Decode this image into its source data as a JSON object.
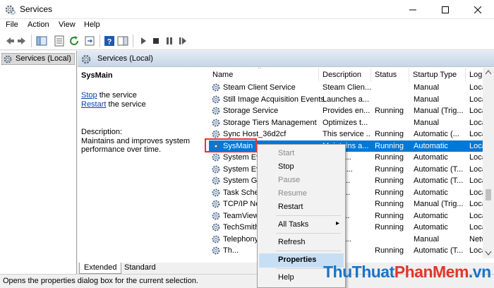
{
  "window": {
    "title": "Services"
  },
  "menubar": [
    "File",
    "Action",
    "View",
    "Help"
  ],
  "tree": {
    "node_label": "Services (Local)"
  },
  "panel": {
    "header": "Services (Local)",
    "service_name": "SysMain",
    "stop_link": "Stop",
    "stop_rest": " the service",
    "restart_link": "Restart",
    "restart_rest": " the service",
    "description_label": "Description:",
    "description_text": "Maintains and improves system performance over time."
  },
  "columns": [
    "Name",
    "Description",
    "Status",
    "Startup Type",
    "Log"
  ],
  "rows": [
    {
      "name": "Steam Client Service",
      "desc": "Steam Clien...",
      "status": "",
      "stype": "Manual",
      "logon": "Loca"
    },
    {
      "name": "Still Image Acquisition Events",
      "desc": "Launches a...",
      "status": "",
      "stype": "Manual",
      "logon": "Loca"
    },
    {
      "name": "Storage Service",
      "desc": "Provides en...",
      "status": "Running",
      "stype": "Manual (Trig...",
      "logon": "Loca"
    },
    {
      "name": "Storage Tiers Management",
      "desc": "Optimizes t...",
      "status": "",
      "stype": "Manual",
      "logon": "Loca"
    },
    {
      "name": "Sync Host_36d2cf",
      "desc": "This service ...",
      "status": "Running",
      "stype": "Automatic (...",
      "logon": "Loca"
    },
    {
      "name": "SysMain",
      "desc": "Maintains a...",
      "status": "Running",
      "stype": "Automatic",
      "logon": "Loca"
    },
    {
      "name": "System Eve",
      "desc": "...rs sy...",
      "status": "Running",
      "stype": "Automatic",
      "logon": "Loca"
    },
    {
      "name": "System Eve",
      "desc": "...rs an...",
      "status": "Running",
      "stype": "Automatic (T...",
      "logon": "Loca"
    },
    {
      "name": "System Gu",
      "desc": "...s an...",
      "status": "Running",
      "stype": "Automatic (T...",
      "logon": "Loca"
    },
    {
      "name": "Task Sched",
      "desc": "...a us...",
      "status": "Running",
      "stype": "Automatic",
      "logon": "Loca"
    },
    {
      "name": "TCP/IP Net",
      "desc": "...pp...",
      "status": "Running",
      "stype": "Manual (Trig...",
      "logon": "Loca"
    },
    {
      "name": "TeamViewe",
      "desc": "...ewe...",
      "status": "Running",
      "stype": "Automatic",
      "logon": "Loca"
    },
    {
      "name": "TechSmith",
      "desc": "...ith ...",
      "status": "Running",
      "stype": "Automatic",
      "logon": "Loca"
    },
    {
      "name": "Telephony",
      "desc": "...s Tel...",
      "status": "",
      "stype": "Manual",
      "logon": "Netw"
    },
    {
      "name": "Th...",
      "desc": "...",
      "status": "Running",
      "stype": "Automatic (T...",
      "logon": "Loca"
    }
  ],
  "context_menu": {
    "start": "Start",
    "stop": "Stop",
    "pause": "Pause",
    "resume": "Resume",
    "restart": "Restart",
    "all_tasks": "All Tasks",
    "refresh": "Refresh",
    "properties": "Properties",
    "help": "Help"
  },
  "tabs": {
    "extended": "Extended",
    "standard": "Standard"
  },
  "statusbar": "Opens the properties dialog box for the current selection.",
  "watermark": {
    "part1": "Thu",
    "part2": "Thuat",
    "part3": "Phan",
    "part4": "Mem",
    "part5": ".vn"
  },
  "colors": {
    "selection": "#0078d7",
    "accent_red": "#e0362c",
    "menu_highlight": "#c6dff5"
  }
}
